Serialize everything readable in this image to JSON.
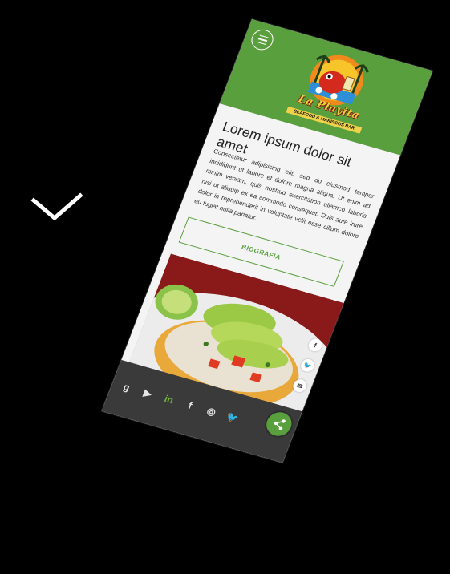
{
  "header": {
    "menu_icon": "hamburger-menu-icon",
    "logo": {
      "title": "La Playita",
      "subtitle": "SEAFOOD & MARISCOS BAR"
    }
  },
  "content": {
    "title": "Lorem ipsum dolor sit amet",
    "paragraph": "Consectetur adipisicing elit, sed do eiusmod tempor incididunt ut labore et dolore magna aliqua. Ut enim ad minim veniam, quis nostrud exercitation ullamco laboris nisi ut aliquip ex ea commodo consequat. Duis aute irure dolor in reprehenderit in voluptate velit esse cillum dolore eu fugiat nulla pariatur.",
    "button_label": "BIOGRAFÍA"
  },
  "side_share": [
    {
      "icon": "facebook-icon",
      "glyph": "f"
    },
    {
      "icon": "twitter-icon",
      "glyph": "🐦"
    },
    {
      "icon": "email-icon",
      "glyph": "✉"
    }
  ],
  "footer": {
    "social": [
      {
        "icon": "google-icon",
        "glyph": "g"
      },
      {
        "icon": "youtube-icon",
        "glyph": "▶"
      },
      {
        "icon": "linkedin-icon",
        "glyph": "in"
      },
      {
        "icon": "facebook-icon",
        "glyph": "f"
      },
      {
        "icon": "instagram-icon",
        "glyph": "◎"
      },
      {
        "icon": "twitter-icon",
        "glyph": "🐦"
      }
    ],
    "share_icon": "share-icon"
  },
  "colors": {
    "brand_green": "#5a9f3d",
    "footer_dark": "#3a3a3a",
    "background": "#000000"
  }
}
